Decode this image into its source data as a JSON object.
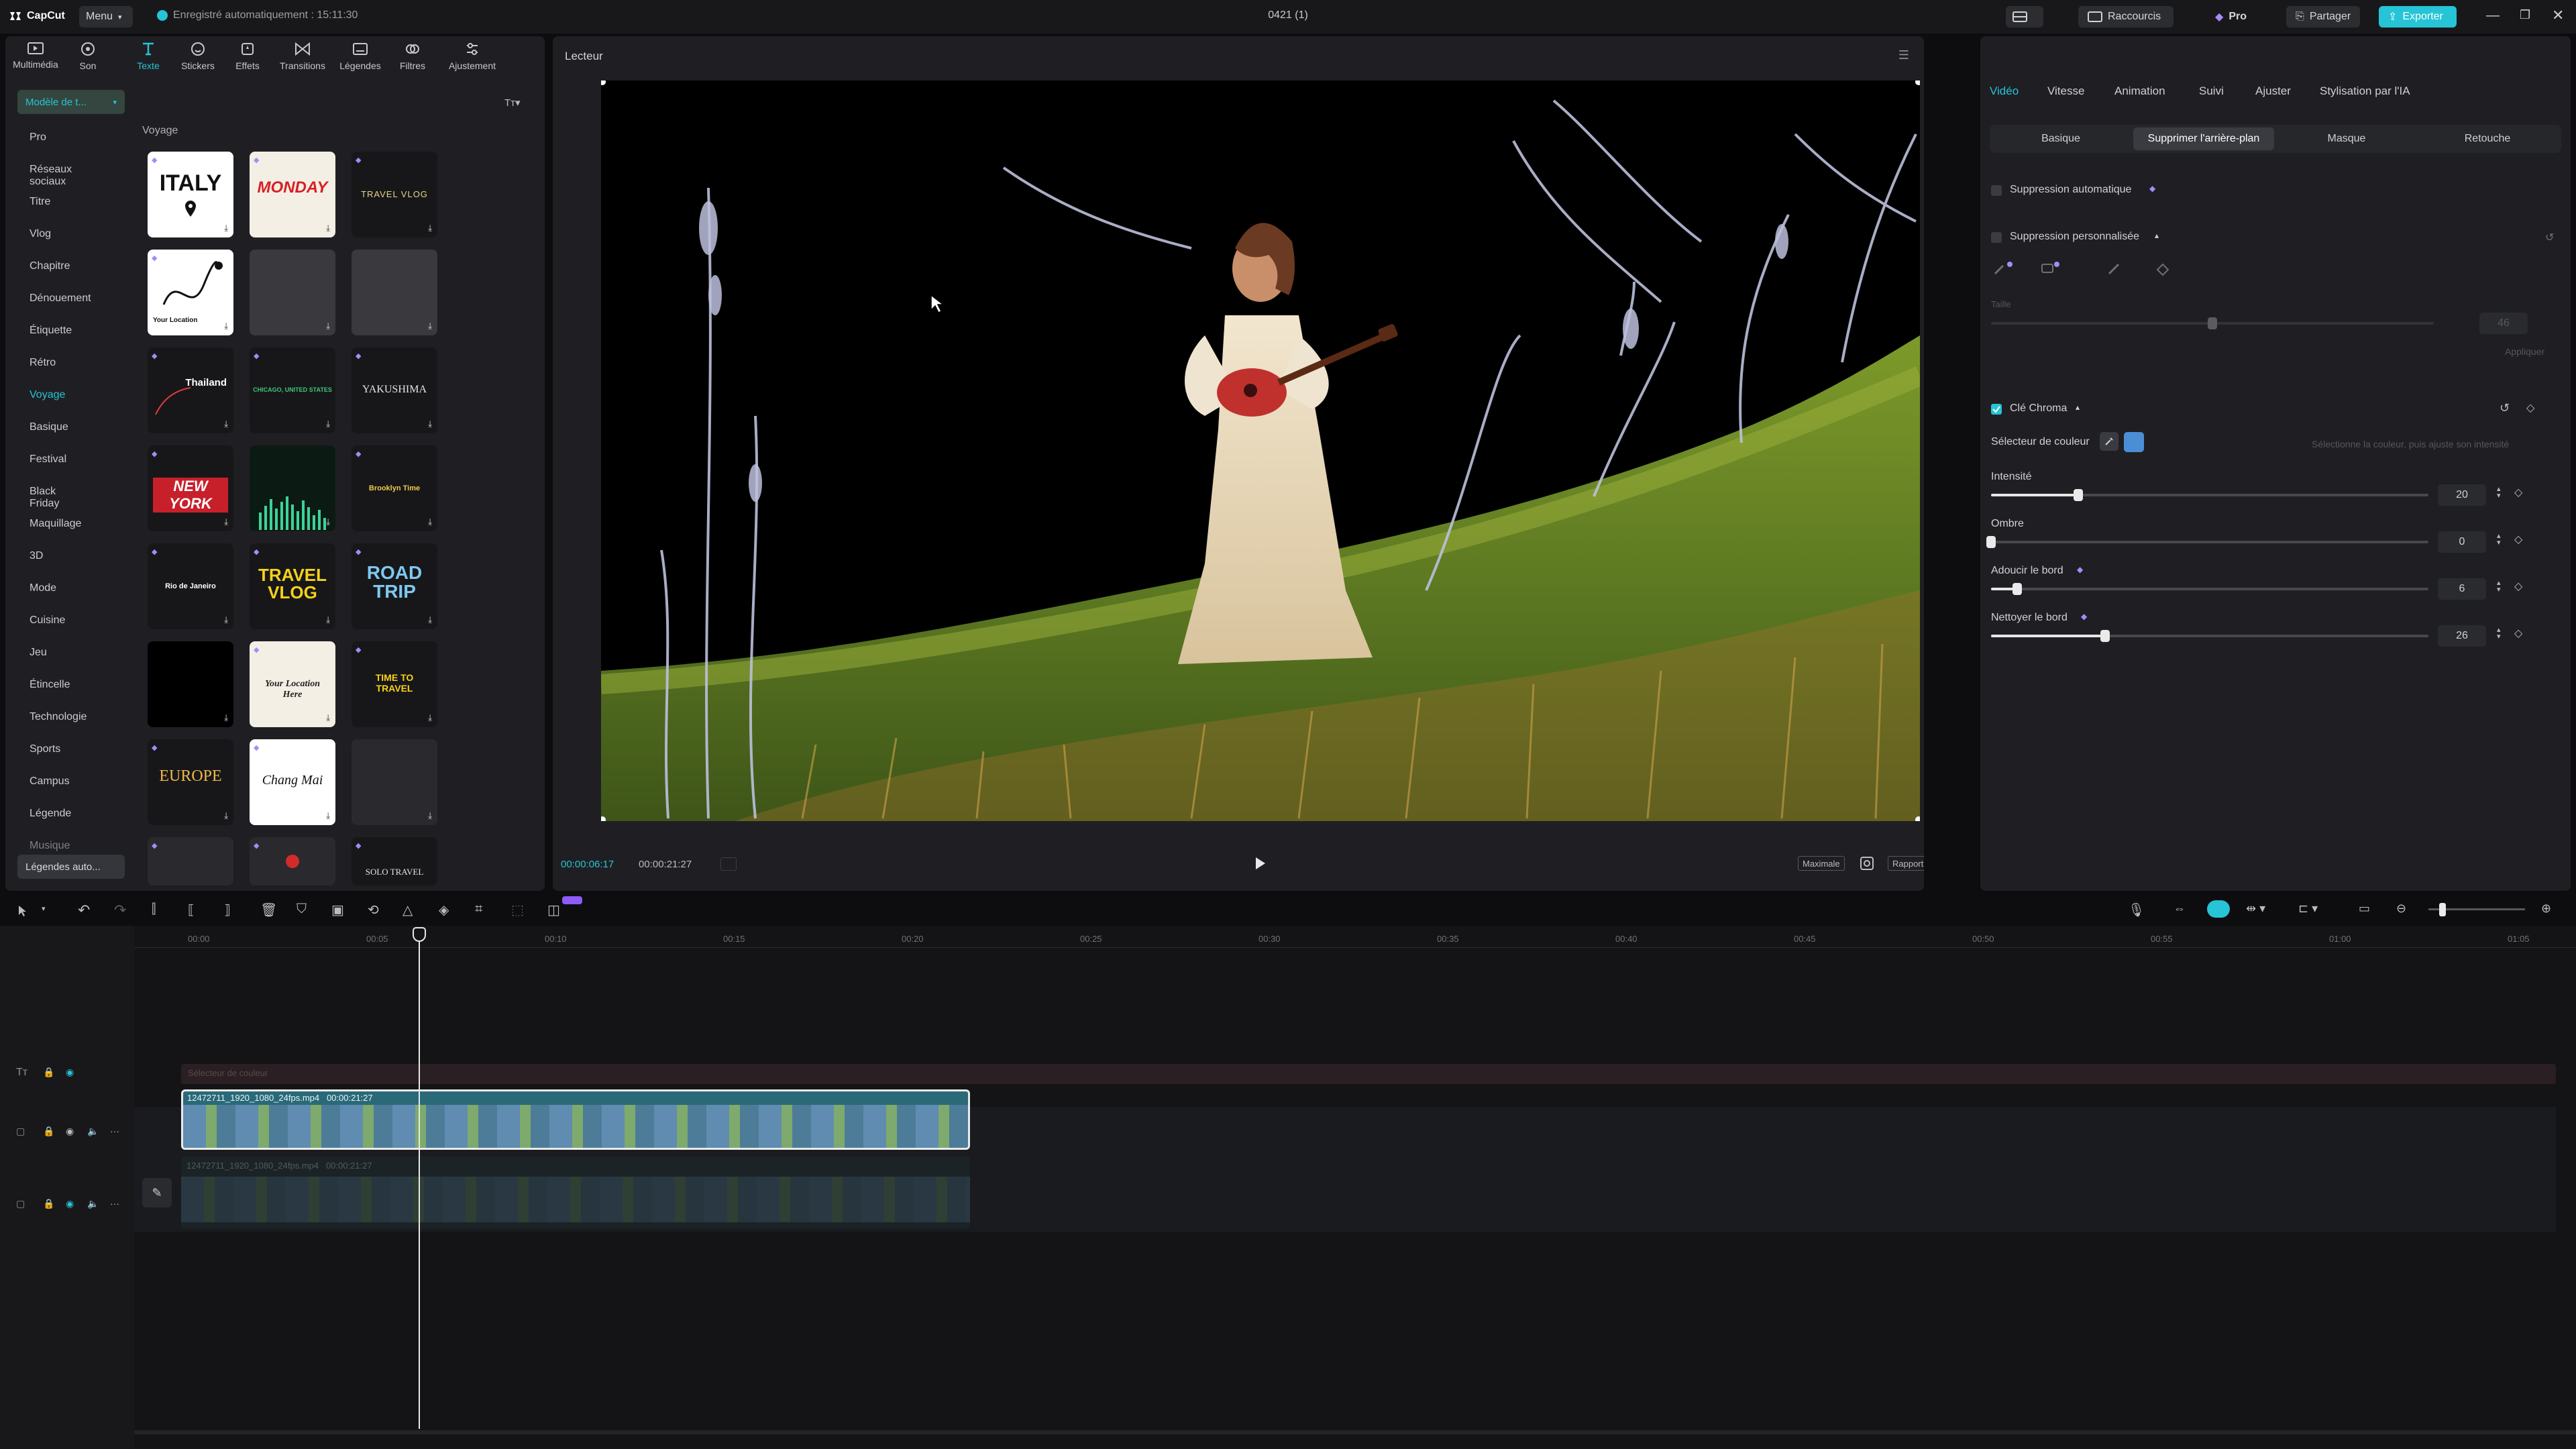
{
  "app": {
    "logo": "CapCut",
    "menu_label": "Menu",
    "autosave": "Enregistré automatiquement : 15:11:30",
    "doc_title": "0421 (1)"
  },
  "titlebar_buttons": {
    "shortcuts": "Raccourcis",
    "pro": "Pro",
    "share": "Partager",
    "export": "Exporter"
  },
  "toolbar": [
    {
      "label": "Multimédia",
      "icon": "media-icon"
    },
    {
      "label": "Son",
      "icon": "audio-icon"
    },
    {
      "label": "Texte",
      "icon": "text-icon"
    },
    {
      "label": "Stickers",
      "icon": "sticker-icon"
    },
    {
      "label": "Effets",
      "icon": "effects-icon"
    },
    {
      "label": "Transitions",
      "icon": "transitions-icon"
    },
    {
      "label": "Légendes",
      "icon": "captions-icon"
    },
    {
      "label": "Filtres",
      "icon": "filters-icon"
    },
    {
      "label": "Ajustement",
      "icon": "adjust-icon"
    }
  ],
  "left_panel": {
    "dropdown": "Modèle de t...",
    "section_title": "Voyage",
    "categories": [
      "Pro",
      "Réseaux sociaux",
      "Titre",
      "Vlog",
      "Chapitre",
      "Dénouement",
      "Étiquette",
      "Rétro",
      "Voyage",
      "Basique",
      "Festival",
      "Black Friday",
      "Maquillage",
      "3D",
      "Mode",
      "Cuisine",
      "Jeu",
      "Étincelle",
      "Technologie",
      "Sports",
      "Campus",
      "Légende",
      "Musique"
    ],
    "bottom_button": "Légendes auto...",
    "templates": [
      [
        "ITALY",
        "MONDAY",
        "TRAVEL VLOG"
      ],
      [
        "Your Location",
        "",
        ""
      ],
      [
        "Thailand",
        "CHICAGO, UNITED STATES",
        "YAKUSHIMA"
      ],
      [
        "NEW YORK",
        "",
        "Brooklyn Time"
      ],
      [
        "Rio de Janeiro",
        "TRAVEL VLOG",
        "ROAD TRIP"
      ],
      [
        "",
        "Your Location Here",
        "TIME TO TRAVEL"
      ],
      [
        "EUROPE",
        "Chang Mai",
        ""
      ],
      [
        "",
        "",
        "SOLO TRAVEL"
      ]
    ]
  },
  "player": {
    "title": "Lecteur",
    "current_time": "00:00:06:17",
    "total_time": "00:00:21:27",
    "btn_max": "Maximale",
    "btn_ratio": "Rapport"
  },
  "right_panel": {
    "tabs": [
      "Vidéo",
      "Vitesse",
      "Animation",
      "Suivi",
      "Ajuster",
      "Stylisation par l'IA"
    ],
    "subtabs": [
      "Basique",
      "Supprimer l'arrière-plan",
      "Masque",
      "Retouche"
    ],
    "auto_removal": "Suppression automatique",
    "custom_removal": "Suppression personnalisée",
    "size_label": "Taille",
    "size_value": "46",
    "apply_label": "Appliquer",
    "chroma_key": "Clé Chroma",
    "color_picker": "Sélecteur de couleur",
    "picker_hint": "Sélectionne la couleur, puis ajuste son intensité",
    "sliders": [
      {
        "label": "Intensité",
        "value": "20",
        "level": 0.2
      },
      {
        "label": "Ombre",
        "value": "0",
        "level": 0.0
      },
      {
        "label": "Adoucir le bord",
        "value": "6",
        "level": 0.06
      },
      {
        "label": "Nettoyer le bord",
        "value": "26",
        "level": 0.26
      }
    ],
    "chroma_color": "#4a8fd6"
  },
  "timeline": {
    "ruler": [
      "00:00",
      "00:05",
      "00:10",
      "00:15",
      "00:20",
      "00:25",
      "00:30",
      "00:35",
      "00:40",
      "00:45",
      "00:50",
      "00:55",
      "01:00",
      "01:05"
    ],
    "text_track_label": "Sélecteur de couleur",
    "clip1_name": "12472711_1920_1080_24fps.mp4",
    "clip1_duration": "00:00:21:27",
    "clip2_name": "12472711_1920_1080_24fps.mp4",
    "clip2_duration": "00:00:21:27",
    "playhead_time": "00:00:06:17"
  },
  "colors": {
    "accent": "#26c4d6",
    "panel": "#1f1f23",
    "bg": "#0d0d0f"
  }
}
